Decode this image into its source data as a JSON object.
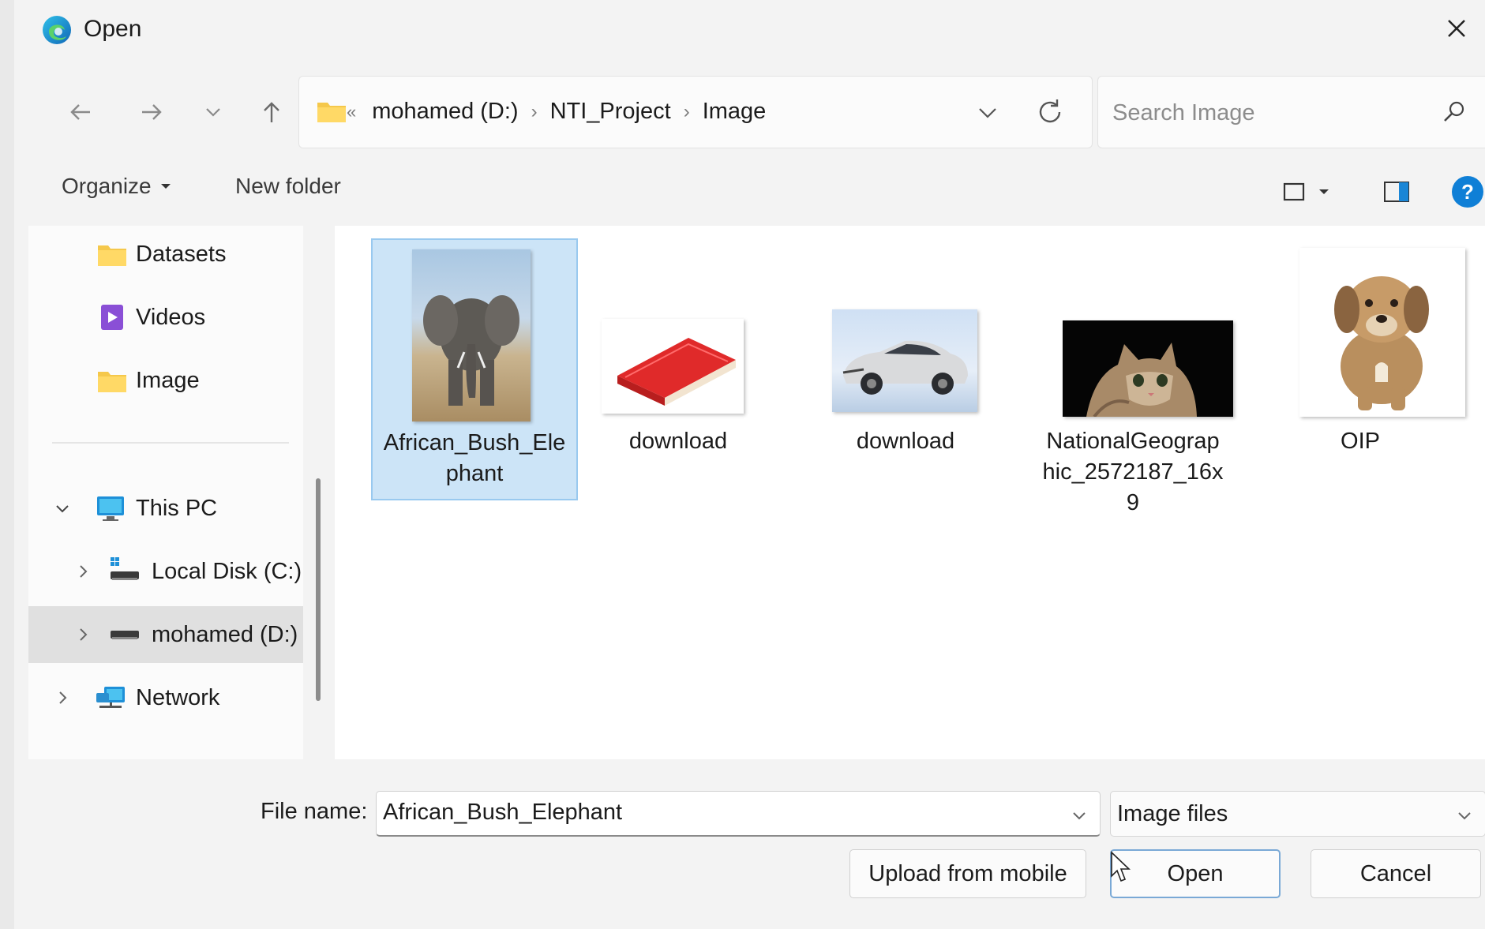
{
  "window": {
    "title": "Open"
  },
  "navigation": {
    "breadcrumb_overflow": "«",
    "breadcrumbs": [
      "mohamed (D:)",
      "NTI_Project",
      "Image"
    ],
    "search_placeholder": "Search Image"
  },
  "toolbar": {
    "organize_label": "Organize",
    "new_folder_label": "New folder"
  },
  "sidebar": {
    "quick_access": [
      {
        "label": "Datasets",
        "icon": "folder-icon"
      },
      {
        "label": "Videos",
        "icon": "videos-folder-icon"
      },
      {
        "label": "Image",
        "icon": "folder-icon"
      }
    ],
    "tree": [
      {
        "label": "This PC",
        "icon": "computer-icon",
        "expanded": true
      },
      {
        "label": "Local Disk (C:)",
        "icon": "windows-drive-icon",
        "expanded": false
      },
      {
        "label": "mohamed (D:)",
        "icon": "drive-icon",
        "expanded": false,
        "selected": true
      },
      {
        "label": "Network",
        "icon": "network-icon",
        "expanded": false
      }
    ]
  },
  "files": [
    {
      "name": "African_Bush_Elephant",
      "name_lines": [
        "African_Bush_Ele",
        "phant"
      ],
      "thumbnail": "elephant",
      "selected": true
    },
    {
      "name": "download",
      "name_lines": [
        "download"
      ],
      "thumbnail": "red-book",
      "selected": false
    },
    {
      "name": "download",
      "name_lines": [
        "download"
      ],
      "thumbnail": "silver-car",
      "selected": false
    },
    {
      "name": "NationalGeographic_2572187_16x9",
      "name_lines": [
        "NationalGeograp",
        "hic_2572187_16x",
        "9"
      ],
      "thumbnail": "cat",
      "selected": false
    },
    {
      "name": "OIP",
      "name_lines": [
        "OIP"
      ],
      "thumbnail": "puppy",
      "selected": false
    }
  ],
  "footer": {
    "file_name_label": "File name:",
    "file_name_value": "African_Bush_Elephant",
    "file_type_value": "Image files",
    "upload_label": "Upload from mobile",
    "open_label": "Open",
    "cancel_label": "Cancel"
  },
  "colors": {
    "selection_fill": "#cce4f7",
    "selection_border": "#99c9ef",
    "help_blue": "#0f7fd6",
    "folder_yellow": "#f5c84b"
  }
}
